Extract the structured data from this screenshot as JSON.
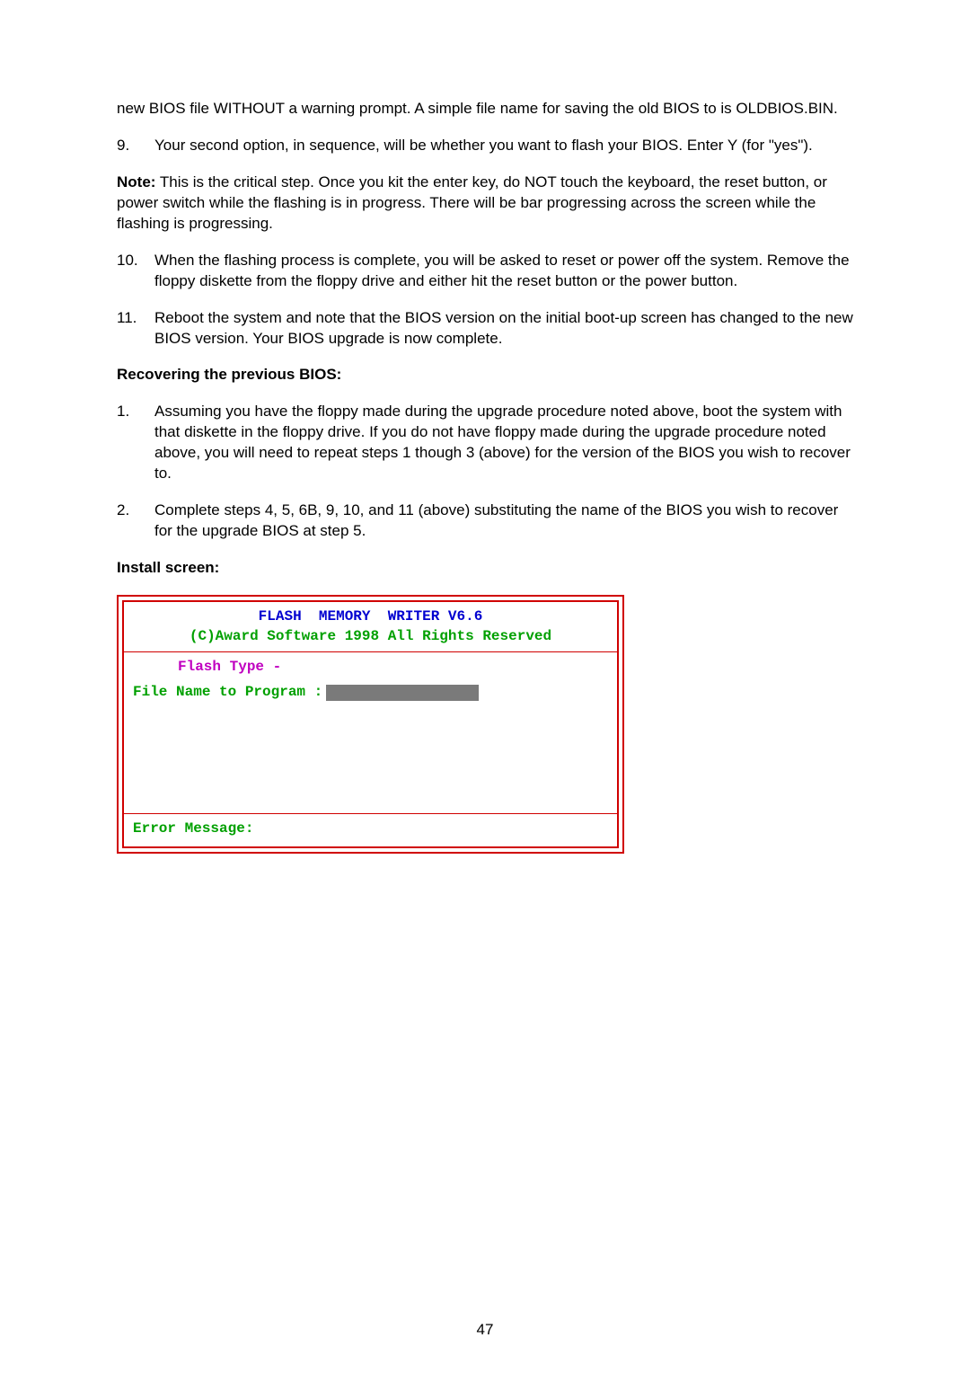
{
  "intro": "new BIOS file WITHOUT a warning prompt.  A simple file name for saving the old BIOS to is OLDBIOS.BIN.",
  "step9": {
    "num": "9.",
    "text": "Your second option, in sequence, will be whether you want to flash your BIOS.  Enter Y (for \"yes\")."
  },
  "note": {
    "label": "Note:",
    "text": " This is the critical step.  Once you kit the enter key, do NOT touch the keyboard, the reset button, or power switch while the flashing is in progress.  There will be bar progressing across the screen while the flashing is progressing."
  },
  "step10": {
    "num": "10.",
    "text": "When the flashing process is complete, you will be asked to reset or power off the system.  Remove the floppy diskette from the floppy drive and either hit the reset button or the power button."
  },
  "step11": {
    "num": "11.",
    "text": "Reboot the system and note that the BIOS version on the initial boot-up screen has changed to the new BIOS version.  Your BIOS upgrade is now complete."
  },
  "recover_heading": "Recovering the previous BIOS:",
  "recover1": {
    "num": "1.",
    "text": "Assuming you have the floppy made during the upgrade procedure noted above, boot the system with that diskette in the floppy drive.  If you do not have floppy made during the upgrade procedure noted above, you will need to repeat steps 1 though 3 (above) for the version of the BIOS you wish to recover to."
  },
  "recover2": {
    "num": "2.",
    "text": "Complete steps 4, 5, 6B, 9, 10, and 11 (above) substituting the name of the BIOS you wish to recover for the upgrade BIOS at step 5."
  },
  "install_heading": "Install screen:",
  "bios": {
    "title": "FLASH  MEMORY  WRITER V6.6",
    "copyright": "(C)Award Software 1998 All Rights Reserved",
    "flash_type": "Flash Type -",
    "file_name_label": "File Name to Program :",
    "error_label": "Error Message:"
  },
  "page_number": "47"
}
